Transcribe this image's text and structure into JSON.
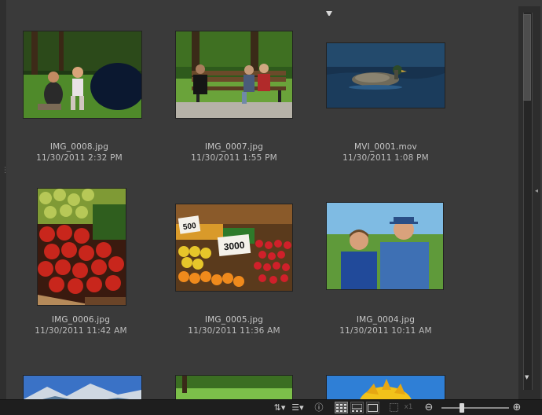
{
  "photos": [
    {
      "filename": "IMG_0008.jpg",
      "date": "11/30/2011 2:32 PM"
    },
    {
      "filename": "IMG_0007.jpg",
      "date": "11/30/2011 1:55 PM"
    },
    {
      "filename": "MVI_0001.mov",
      "date": "11/30/2011 1:08 PM"
    },
    {
      "filename": "IMG_0006.jpg",
      "date": "11/30/2011 11:42 AM"
    },
    {
      "filename": "IMG_0005.jpg",
      "date": "11/30/2011 11:36 AM"
    },
    {
      "filename": "IMG_0004.jpg",
      "date": "11/30/2011 10:11 AM"
    }
  ],
  "thumb_text": {
    "price_sign_1": "500",
    "price_sign_2": "3000"
  },
  "toolbar": {
    "sort_label": "⇅▾",
    "filter_label": "☰▾",
    "info_label": "ⓘ",
    "x1_label": "x1",
    "zoom_out_label": "⊖",
    "zoom_in_label": "⊕"
  },
  "zoom": {
    "level_fraction": 0.27
  },
  "icons": [
    "sort-icon",
    "filter-icon",
    "info-icon",
    "grid-view-icon",
    "split-view-icon",
    "single-view-icon",
    "fit-icon",
    "zoom-out-icon",
    "zoom-in-icon"
  ]
}
